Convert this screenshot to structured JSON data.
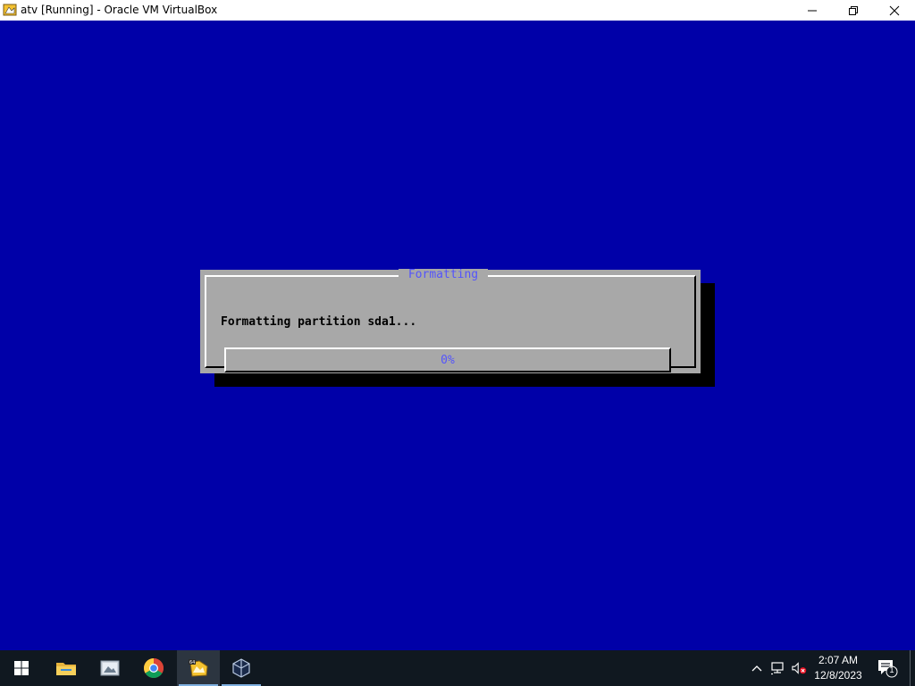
{
  "window": {
    "title": "atv [Running] - Oracle VM VirtualBox",
    "controls": [
      "minimize",
      "restore",
      "close"
    ]
  },
  "vm": {
    "background_color": "#0000a8",
    "dialog": {
      "title": "Formatting",
      "message": "Formatting partition sda1...",
      "progress_label": "0%",
      "progress_value": 0
    }
  },
  "taskbar": {
    "apps": [
      {
        "name": "start",
        "icon": "windows-logo-icon"
      },
      {
        "name": "file-explorer",
        "icon": "folder-icon"
      },
      {
        "name": "photos",
        "icon": "photos-icon"
      },
      {
        "name": "chrome",
        "icon": "chrome-icon"
      },
      {
        "name": "virtualbox-vm",
        "icon": "virtualbox-vm-icon",
        "active": true
      },
      {
        "name": "virtualbox-manager",
        "icon": "virtualbox-cube-icon"
      }
    ],
    "tray": {
      "icons": [
        "chevron-up-icon",
        "network-icon",
        "volume-muted-icon"
      ],
      "time": "2:07 AM",
      "date": "12/8/2023",
      "notification_count": "1"
    }
  }
}
